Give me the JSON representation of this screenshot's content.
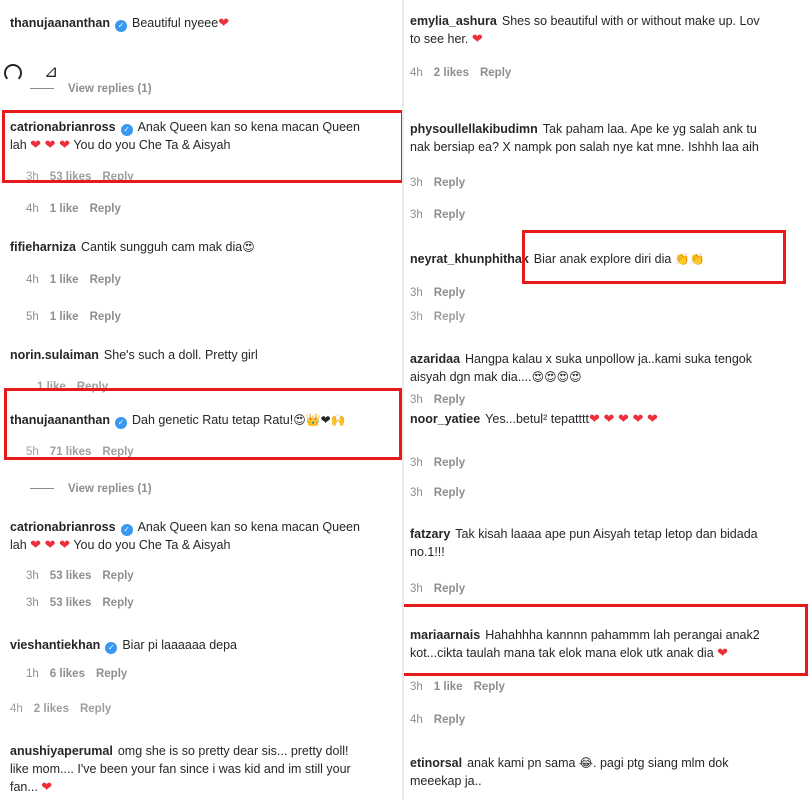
{
  "left": {
    "c1": {
      "user": "thanujaananthan",
      "text": "Beautiful nyeee",
      "emoji": "❤"
    },
    "view_replies_1": "View replies (1)",
    "c2": {
      "user": "catrionabrianross",
      "line1": "Anak Queen kan so kena macan Queen",
      "line2a": "lah",
      "hearts": "❤ ❤ ❤",
      "line2b": "You do you Che Ta & Aisyah",
      "time": "3h",
      "likes": "53 likes",
      "reply": "Reply"
    },
    "meta_a": {
      "time": "4h",
      "likes": "1 like",
      "reply": "Reply"
    },
    "c3": {
      "user": "fifieharniza",
      "text": "Cantik sungguh cam mak dia",
      "emoji": "😍",
      "time": "4h",
      "likes": "1 like",
      "reply": "Reply"
    },
    "meta_b": {
      "time": "5h",
      "likes": "1 like",
      "reply": "Reply"
    },
    "c4": {
      "user": "norin.sulaiman",
      "text": "She's such a doll. Pretty girl",
      "time": "",
      "likes": "1 like",
      "reply": "Reply"
    },
    "c5": {
      "user": "thanujaananthan",
      "text": "Dah genetic Ratu tetap Ratu!",
      "emoji": "😍👑❤🙌",
      "time": "5h",
      "likes": "71 likes",
      "reply": "Reply"
    },
    "view_replies_2": "View replies (1)",
    "c6": {
      "user": "catrionabrianross",
      "line1": "Anak Queen kan so kena macan Queen",
      "line2a": "lah",
      "hearts": "❤ ❤ ❤",
      "line2b": "You do you Che Ta & Aisyah",
      "time": "3h",
      "likes": "53 likes",
      "reply": "Reply"
    },
    "meta_c": {
      "time": "3h",
      "likes": "53 likes",
      "reply": "Reply"
    },
    "c7": {
      "user": "vieshantiekhan",
      "text": "Biar pi laaaaaa depa",
      "time": "1h",
      "likes": "6 likes",
      "reply": "Reply"
    },
    "meta_d": {
      "time": "4h",
      "likes": "2 likes",
      "reply": "Reply"
    },
    "c8": {
      "user": "anushiyaperumal",
      "line1": "omg she is so pretty dear sis... pretty doll!",
      "line2": "like mom.... I've been your fan since i was kid and im still your",
      "line3": "fan...",
      "emoji": "❤"
    }
  },
  "right": {
    "c1": {
      "user": "emylia_ashura",
      "line1": "Shes so beautiful with or without make up. Lov",
      "line2": "to see her.",
      "emoji": "❤",
      "time": "4h",
      "likes": "2 likes",
      "reply": "Reply"
    },
    "c2": {
      "user": "physoullellakibudimn",
      "line1": "Tak paham laa. Ape ke yg salah ank tu",
      "line2": "nak bersiap ea? X nampk pon salah nye kat mne. Ishhh laa aih",
      "time": "3h",
      "reply": "Reply"
    },
    "meta_a": {
      "time": "3h",
      "reply": "Reply"
    },
    "c3": {
      "user": "neyrat_khunphithak",
      "text": "Biar anak explore diri dia",
      "emoji": "👏👏",
      "time": "3h",
      "reply": "Reply"
    },
    "meta_b": {
      "time": "3h",
      "reply": "Reply"
    },
    "c4": {
      "user": "azaridaa",
      "line1": "Hangpa kalau x suka unpollow ja..kami suka tengok",
      "line2": "aisyah dgn mak dia....",
      "emoji": "😍😍😍😍",
      "time": "3h",
      "reply": "Reply"
    },
    "c5": {
      "user": "noor_yatiee",
      "text": "Yes...betul² tepatttt",
      "emoji": "❤ ❤ ❤ ❤ ❤",
      "time": "3h",
      "reply": "Reply"
    },
    "meta_c": {
      "time": "3h",
      "reply": "Reply"
    },
    "c6": {
      "user": "fatzary",
      "line1": "Tak kisah laaaa ape pun Aisyah tetap letop dan bidada",
      "line2": "no.1!!!",
      "time": "3h",
      "reply": "Reply"
    },
    "c7": {
      "user": "mariaarnais",
      "line1": "Hahahhha kannnn pahammm lah perangai anak2",
      "line2": "kot...cikta taulah mana tak elok mana elok utk anak dia",
      "emoji": "❤",
      "time": "3h",
      "likes": "1 like",
      "reply": "Reply"
    },
    "meta_d": {
      "time": "4h",
      "reply": "Reply"
    },
    "c8": {
      "user": "etinorsal",
      "line1": "anak kami pn sama",
      "emoji": "😂",
      "line1b": ". pagi ptg siang mlm dok",
      "line2": "meeekap ja.."
    }
  }
}
